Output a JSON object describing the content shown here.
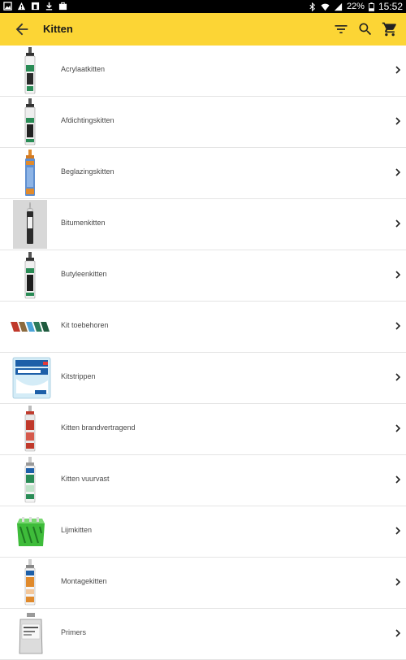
{
  "status": {
    "battery": "22%",
    "time": "15:52"
  },
  "appbar": {
    "title": "Kitten"
  },
  "items": [
    {
      "label": "Acrylaatkitten"
    },
    {
      "label": "Afdichtingskitten"
    },
    {
      "label": "Beglazingskitten"
    },
    {
      "label": "Bitumenkitten"
    },
    {
      "label": "Butyleenkitten"
    },
    {
      "label": "Kit toebehoren"
    },
    {
      "label": "Kitstrippen"
    },
    {
      "label": "Kitten brandvertragend"
    },
    {
      "label": "Kitten vuurvast"
    },
    {
      "label": "Lijmkitten"
    },
    {
      "label": "Montagekitten"
    },
    {
      "label": "Primers"
    }
  ]
}
